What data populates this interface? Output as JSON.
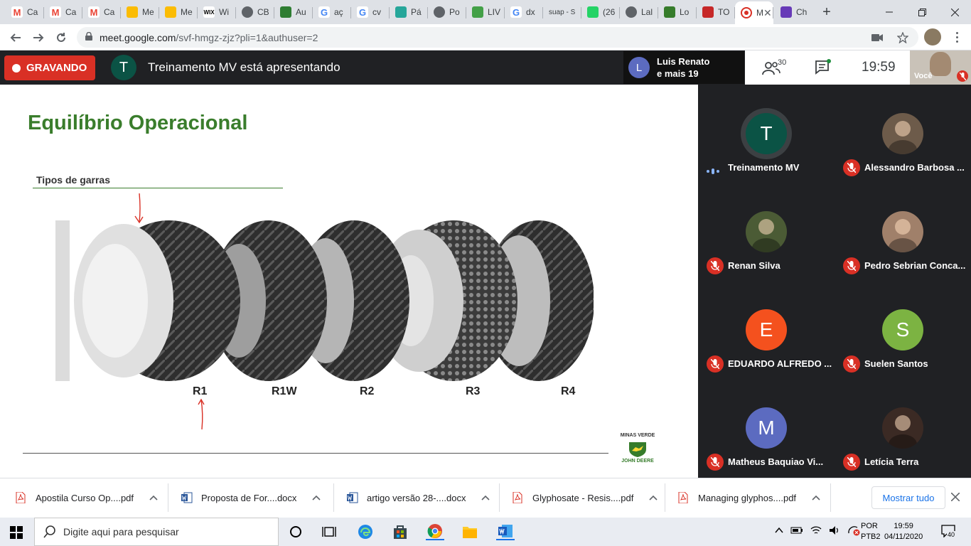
{
  "browser": {
    "tabs": [
      {
        "label": "Ca",
        "icon": "gmail-icon",
        "color": "#ea4335"
      },
      {
        "label": "Ca",
        "icon": "gmail-icon",
        "color": "#ea4335"
      },
      {
        "label": "Ca",
        "icon": "gmail-icon",
        "color": "#ea4335"
      },
      {
        "label": "Me",
        "icon": "drive-icon",
        "color": "#fbbc04"
      },
      {
        "label": "Me",
        "icon": "drive-icon",
        "color": "#fbbc04"
      },
      {
        "label": "Wi",
        "icon": "wix-icon",
        "color": "#000000"
      },
      {
        "label": "CB",
        "icon": "globe-icon",
        "color": "#5f6368"
      },
      {
        "label": "Au",
        "icon": "flag-icon",
        "color": "#2e7d32"
      },
      {
        "label": "aç",
        "icon": "google-icon",
        "color": "#4285f4"
      },
      {
        "label": "cv",
        "icon": "google-icon",
        "color": "#4285f4"
      },
      {
        "label": "Pá",
        "icon": "leaf-icon",
        "color": "#26a69a"
      },
      {
        "label": "Po",
        "icon": "globe-icon",
        "color": "#5f6368"
      },
      {
        "label": "LIV",
        "icon": "leaf-icon",
        "color": "#43a047"
      },
      {
        "label": "dx",
        "icon": "google-icon",
        "color": "#4285f4"
      },
      {
        "label": "suap - S",
        "icon": "none",
        "color": "#ffffff"
      },
      {
        "label": "(26",
        "icon": "whatsapp-icon",
        "color": "#25d366"
      },
      {
        "label": "Lal",
        "icon": "globe-icon",
        "color": "#5f6368"
      },
      {
        "label": "Lo",
        "icon": "deere-icon",
        "color": "#367c2b"
      },
      {
        "label": "TO",
        "icon": "red-icon",
        "color": "#c62828"
      },
      {
        "label": "M",
        "icon": "record-icon",
        "color": "#d93025"
      },
      {
        "label": "Ch",
        "icon": "forms-icon",
        "color": "#673ab7"
      }
    ],
    "new_tab": "+",
    "url_host": "meet.google.com",
    "url_path": "/svf-hmgz-zjz?pli=1&authuser=2"
  },
  "meet": {
    "recording_label": "GRAVANDO",
    "presenter_initial": "T",
    "presenting_text": "Treinamento MV está apresentando",
    "viewer_initial": "L",
    "viewer_line1": "Luis Renato",
    "viewer_line2": "e mais 19",
    "participants_count": "30",
    "time": "19:59",
    "self_label": "Você"
  },
  "slide": {
    "title": "Equilíbrio Operacional",
    "subtitle": "Tipos de garras",
    "tire_labels": [
      "R1",
      "R1W",
      "R2",
      "R3",
      "R4"
    ],
    "brand_top": "MINAS VERDE",
    "brand_bottom": "JOHN DEERE",
    "brand_color": "#367c2b",
    "title_color": "#3a7d2c"
  },
  "participants": [
    {
      "name": "Treinamento MV",
      "initial": "T",
      "color": "#0b5345",
      "muted": false,
      "photo": false
    },
    {
      "name": "Alessandro Barbosa ...",
      "initial": "",
      "color": "#6d5b4a",
      "muted": true,
      "photo": true
    },
    {
      "name": "Renan Silva",
      "initial": "",
      "color": "#4b5b35",
      "muted": true,
      "photo": true
    },
    {
      "name": "Pedro Sebrian Conca...",
      "initial": "",
      "color": "#a0806a",
      "muted": true,
      "photo": true
    },
    {
      "name": "EDUARDO ALFREDO ...",
      "initial": "E",
      "color": "#f4511e",
      "muted": true,
      "photo": false
    },
    {
      "name": "Suelen Santos",
      "initial": "S",
      "color": "#7cb342",
      "muted": true,
      "photo": false
    },
    {
      "name": "Matheus Baquiao Vi...",
      "initial": "M",
      "color": "#5c6bc0",
      "muted": true,
      "photo": false
    },
    {
      "name": "Letícia Terra",
      "initial": "",
      "color": "#3b2a24",
      "muted": true,
      "photo": true
    }
  ],
  "downloads": {
    "items": [
      {
        "name": "Apostila Curso Op....pdf",
        "type": "pdf"
      },
      {
        "name": "Proposta de For....docx",
        "type": "docx"
      },
      {
        "name": "artigo versão 28-....docx",
        "type": "docx"
      },
      {
        "name": "Glyphosate - Resis....pdf",
        "type": "pdf"
      },
      {
        "name": "Managing glyphos....pdf",
        "type": "pdf"
      }
    ],
    "show_all": "Mostrar tudo"
  },
  "taskbar": {
    "search_placeholder": "Digite aqui para pesquisar",
    "lang_1": "POR",
    "lang_2": "PTB2",
    "time": "19:59",
    "date": "04/11/2020",
    "notifications": "40"
  }
}
